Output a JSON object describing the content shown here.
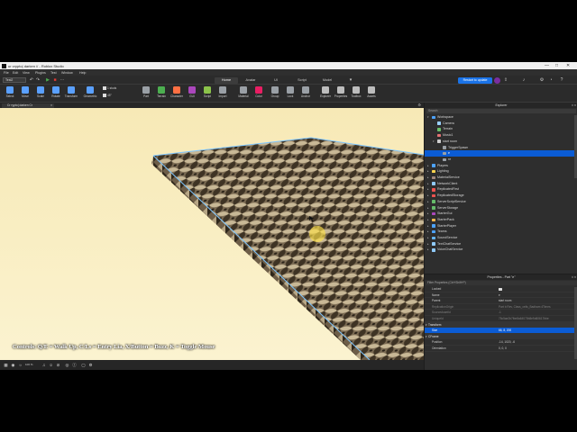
{
  "window": {
    "title": "ur crypto| darken // - Roblox Studio",
    "controls": [
      "—",
      "□",
      "✕"
    ]
  },
  "menu": [
    "File",
    "Edit",
    "View",
    "Plugins",
    "Test",
    "Window",
    "Help"
  ],
  "ribbon": {
    "place_select": "Test2",
    "tabs": [
      "Home",
      "Avatar",
      "UI",
      "Script",
      "Model"
    ],
    "active_tab": "Home",
    "restart_label": "Restart to update",
    "tools": [
      {
        "label": "Select",
        "color": "#5aa0ff"
      },
      {
        "label": "Move",
        "color": "#5aa0ff"
      },
      {
        "label": "Scale",
        "color": "#5aa0ff"
      },
      {
        "label": "Rotate",
        "color": "#5aa0ff"
      },
      {
        "label": "Transform",
        "color": "#5aa0ff"
      },
      {
        "label": "Geometric",
        "color": "#5aa0ff"
      },
      {
        "label": "Part",
        "color": "#9aa0a6"
      },
      {
        "label": "Terrain",
        "color": "#4caf50"
      },
      {
        "label": "Character",
        "color": "#ff7043"
      },
      {
        "label": "GUI",
        "color": "#ab47bc"
      },
      {
        "label": "Script",
        "color": "#8bc34a"
      },
      {
        "label": "Import",
        "color": "#9aa0a6"
      },
      {
        "label": "Material",
        "color": "#9aa0a6"
      },
      {
        "label": "Color",
        "color": "#e91e63"
      },
      {
        "label": "Group",
        "color": "#9aa0a6"
      },
      {
        "label": "Lock",
        "color": "#9aa0a6"
      },
      {
        "label": "Anchor",
        "color": "#9aa0a6"
      },
      {
        "label": "Explorer",
        "color": "#bdbdbd"
      },
      {
        "label": "Properties",
        "color": "#bdbdbd"
      },
      {
        "label": "Toolbox",
        "color": "#bdbdbd"
      },
      {
        "label": "Assets",
        "color": "#bdbdbd"
      }
    ],
    "snap_move": "1 studs",
    "snap_rotate": "45°"
  },
  "viewport": {
    "tab_label": "Cr rypto| darken Cr",
    "controls_overlay": "Controls: Q/E = Walk Up, C/Ls = Entry Lia, X/Button = Buzz, K = Toggle Mouse"
  },
  "bottombar": {
    "zoom": "100 %"
  },
  "explorer": {
    "title": "Explorer",
    "search_placeholder": "Search",
    "items": [
      {
        "label": "Workspace",
        "depth": 0,
        "expanded": true,
        "icon": "#4da3ff"
      },
      {
        "label": "Camera",
        "depth": 1,
        "expanded": null,
        "icon": "#9ad0ff"
      },
      {
        "label": "Terrain",
        "depth": 1,
        "expanded": null,
        "icon": "#6abf69"
      },
      {
        "label": "Music1",
        "depth": 1,
        "expanded": null,
        "icon": "#e57373"
      },
      {
        "label": "start room",
        "depth": 1,
        "expanded": true,
        "icon": "#cfcfcf"
      },
      {
        "label": "TriggerSpawn",
        "depth": 2,
        "expanded": null,
        "icon": "#9aa0a6"
      },
      {
        "label": "e",
        "depth": 2,
        "expanded": null,
        "icon": "#9aa0a6",
        "selected": true
      },
      {
        "label": "re",
        "depth": 2,
        "expanded": null,
        "icon": "#9aa0a6"
      },
      {
        "label": "Players",
        "depth": 0,
        "expanded": false,
        "icon": "#4da3ff"
      },
      {
        "label": "Lighting",
        "depth": 0,
        "expanded": false,
        "icon": "#ffd54f"
      },
      {
        "label": "MaterialService",
        "depth": 0,
        "expanded": false,
        "icon": "#a1887f"
      },
      {
        "label": "NetworkClient",
        "depth": 0,
        "expanded": false,
        "icon": "#90caf9"
      },
      {
        "label": "ReplicatedFirst",
        "depth": 0,
        "expanded": false,
        "icon": "#ef5350"
      },
      {
        "label": "ReplicatedStorage",
        "depth": 0,
        "expanded": false,
        "icon": "#ef5350"
      },
      {
        "label": "ServerScriptService",
        "depth": 0,
        "expanded": false,
        "icon": "#66bb6a"
      },
      {
        "label": "ServerStorage",
        "depth": 0,
        "expanded": false,
        "icon": "#66bb6a"
      },
      {
        "label": "StarterGui",
        "depth": 0,
        "expanded": false,
        "icon": "#ab47bc"
      },
      {
        "label": "StarterPack",
        "depth": 0,
        "expanded": false,
        "icon": "#ffb74d"
      },
      {
        "label": "StarterPlayer",
        "depth": 0,
        "expanded": false,
        "icon": "#4da3ff"
      },
      {
        "label": "Teams",
        "depth": 0,
        "expanded": false,
        "icon": "#4da3ff"
      },
      {
        "label": "SoundService",
        "depth": 0,
        "expanded": false,
        "icon": "#64b5f6"
      },
      {
        "label": "TextChatService",
        "depth": 0,
        "expanded": false,
        "icon": "#90caf9"
      },
      {
        "label": "VoiceChatService",
        "depth": 0,
        "expanded": false,
        "icon": "#90caf9"
      }
    ]
  },
  "properties": {
    "title": "Properties - Part \"e\"",
    "filter_placeholder": "Filter Properties (Ctrl+Shift+P)",
    "rows": [
      {
        "name": "Locked",
        "value": "",
        "type": "checkbox"
      },
      {
        "name": "Name",
        "value": "e"
      },
      {
        "name": "Parent",
        "value": "start room"
      },
      {
        "name": "ReplicationOrigin",
        "value": "Part b Rev, Class_cells_Badham 4Times",
        "dim": true
      },
      {
        "name": "SourceAssetId",
        "value": "-1",
        "dim": true
      },
      {
        "name": "UniqueId",
        "value": "75c5ae2b7fbe8a64070b8e9d60617bbe",
        "dim": true
      },
      {
        "name": "Transform",
        "value": "",
        "type": "section"
      },
      {
        "name": "Size",
        "value": "66, 8, 200",
        "highlight": true
      },
      {
        "name": "CFrame",
        "value": "",
        "type": "section"
      },
      {
        "name": "Position",
        "value": "-14, 1020, -6"
      },
      {
        "name": "Orientation",
        "value": "0, 0, 0"
      }
    ]
  }
}
